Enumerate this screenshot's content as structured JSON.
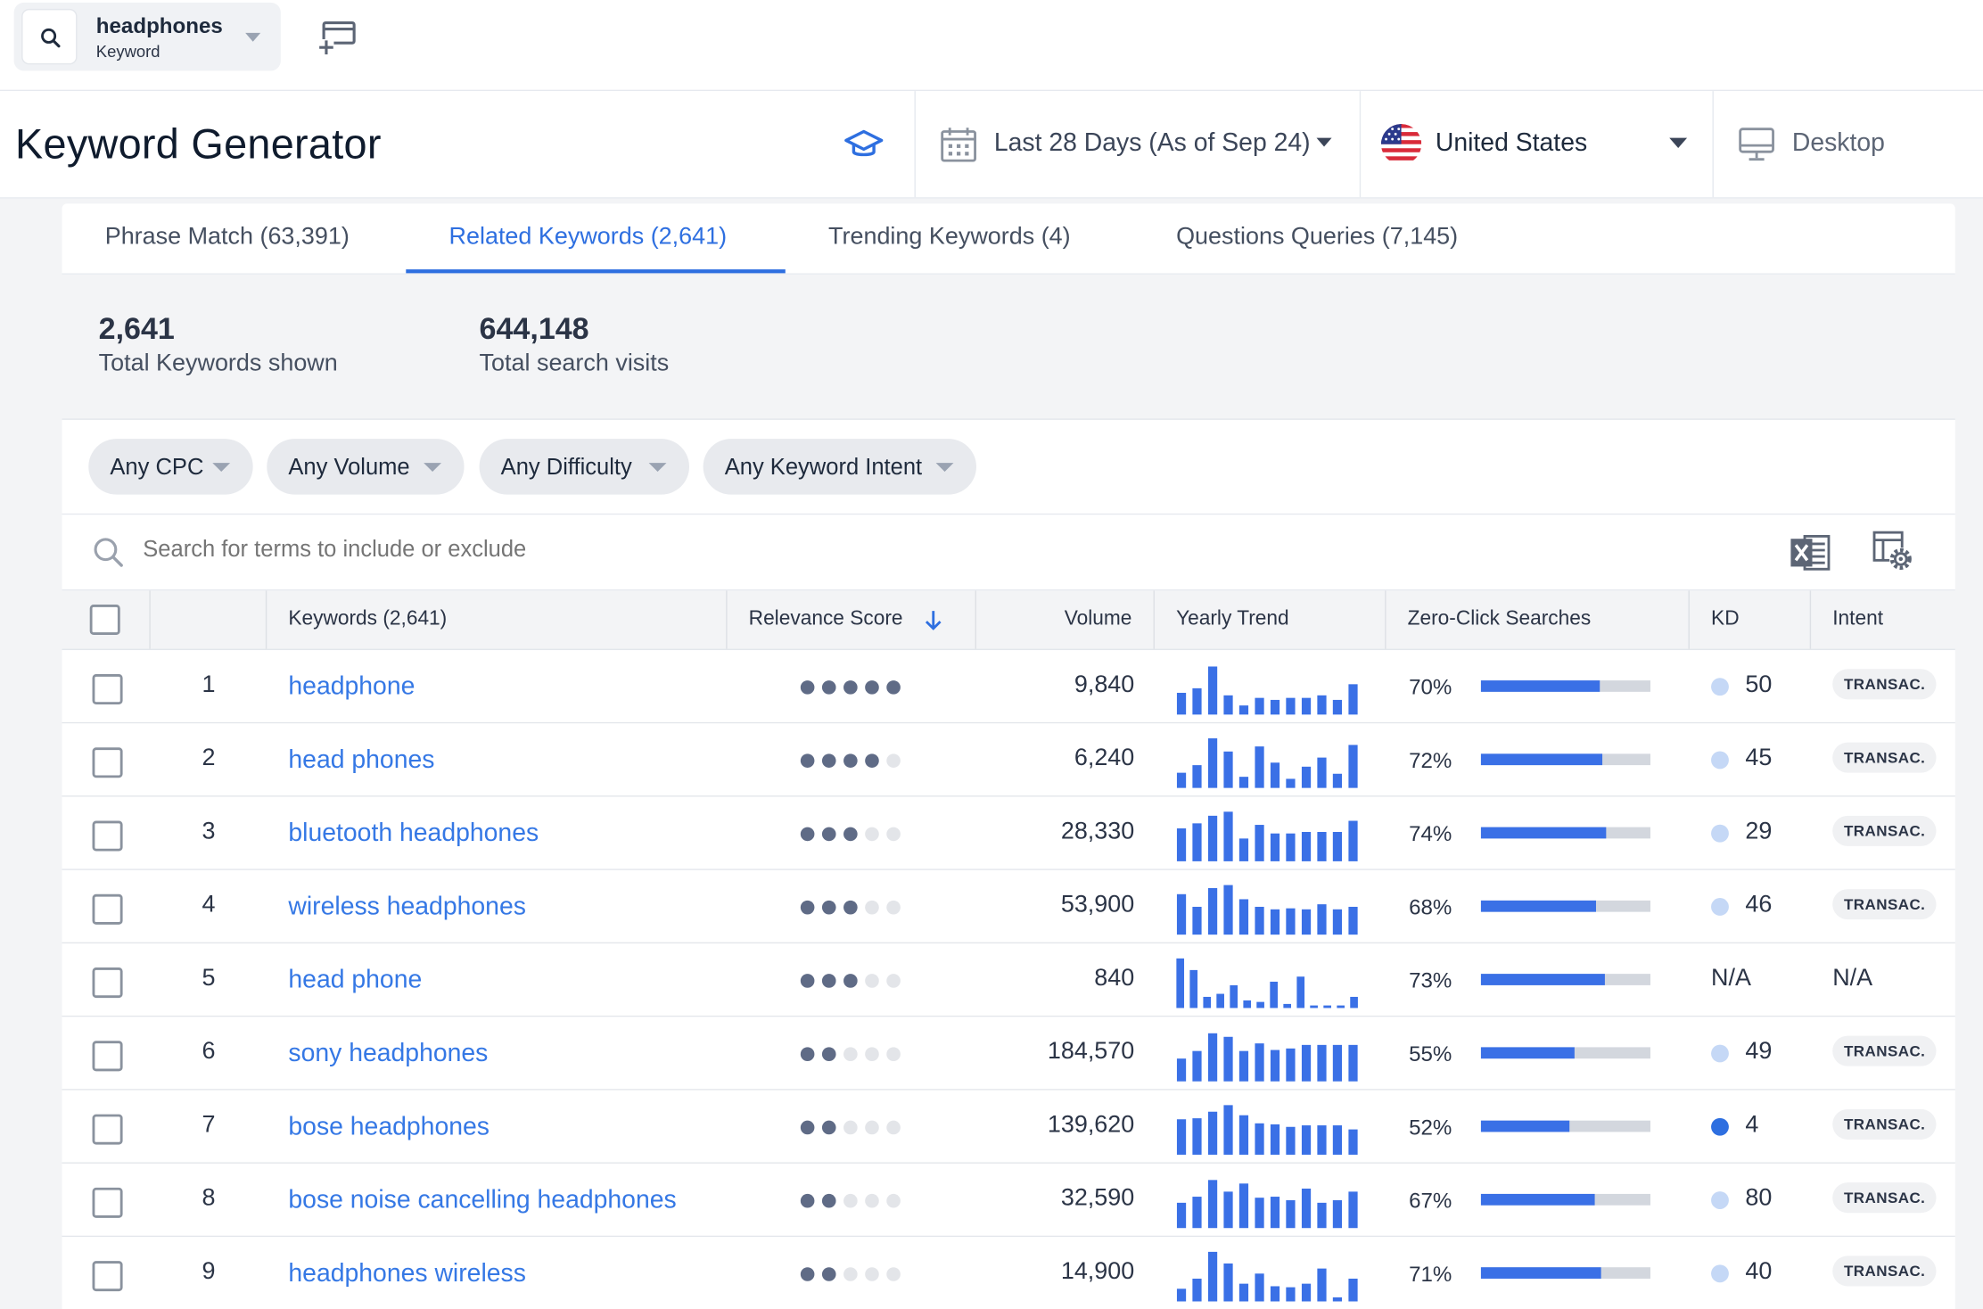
{
  "topbar": {
    "keyword": "headphones",
    "keyword_type": "Keyword"
  },
  "header": {
    "title": "Keyword Generator",
    "date_range": "Last 28 Days (As of Sep 24)",
    "country": "United States",
    "device": "Desktop"
  },
  "tabs": [
    {
      "label": "Phrase Match (63,391)"
    },
    {
      "label": "Related Keywords (2,641)"
    },
    {
      "label": "Trending Keywords (4)"
    },
    {
      "label": "Questions Queries (7,145)"
    }
  ],
  "stats": {
    "keywords_value": "2,641",
    "keywords_label": "Total Keywords shown",
    "visits_value": "644,148",
    "visits_label": "Total search visits"
  },
  "filters": {
    "cpc": "Any CPC",
    "volume": "Any Volume",
    "difficulty": "Any Difficulty",
    "intent": "Any Keyword Intent"
  },
  "search": {
    "placeholder": "Search for terms to include or exclude"
  },
  "table": {
    "headers": {
      "keywords": "Keywords (2,641)",
      "relevance": "Relevance Score",
      "volume": "Volume",
      "trend": "Yearly Trend",
      "zero_click": "Zero-Click Searches",
      "kd": "KD",
      "intent": "Intent"
    },
    "colors": {
      "link": "#3578e5",
      "trend_bar": "#3a70e6",
      "kd_light": "#c5d8f6",
      "kd_strong": "#2e6fe0"
    },
    "rows": [
      {
        "num": "1",
        "keyword": "headphone",
        "relevance": 5,
        "volume": "9,840",
        "trend": [
          0.43,
          0.52,
          0.95,
          0.38,
          0.18,
          0.33,
          0.29,
          0.33,
          0.33,
          0.38,
          0.29,
          0.6
        ],
        "zero_click": "70%",
        "zc_pct": 70,
        "kd": "50",
        "kd_level": "light",
        "intent": "TRANSAC."
      },
      {
        "num": "2",
        "keyword": "head phones",
        "relevance": 4,
        "volume": "6,240",
        "trend": [
          0.3,
          0.45,
          0.98,
          0.72,
          0.22,
          0.82,
          0.5,
          0.18,
          0.42,
          0.6,
          0.28,
          0.85
        ],
        "zero_click": "72%",
        "zc_pct": 72,
        "kd": "45",
        "kd_level": "light",
        "intent": "TRANSAC."
      },
      {
        "num": "3",
        "keyword": "bluetooth headphones",
        "relevance": 3,
        "volume": "28,330",
        "trend": [
          0.65,
          0.75,
          0.9,
          0.98,
          0.45,
          0.72,
          0.55,
          0.55,
          0.58,
          0.58,
          0.58,
          0.8
        ],
        "zero_click": "74%",
        "zc_pct": 74,
        "kd": "29",
        "kd_level": "light",
        "intent": "TRANSAC."
      },
      {
        "num": "4",
        "keyword": "wireless headphones",
        "relevance": 3,
        "volume": "53,900",
        "trend": [
          0.8,
          0.55,
          0.92,
          0.98,
          0.7,
          0.55,
          0.5,
          0.52,
          0.5,
          0.6,
          0.5,
          0.55
        ],
        "zero_click": "68%",
        "zc_pct": 68,
        "kd": "46",
        "kd_level": "light",
        "intent": "TRANSAC."
      },
      {
        "num": "5",
        "keyword": "head phone",
        "relevance": 3,
        "volume": "840",
        "trend": [
          0.98,
          0.75,
          0.22,
          0.28,
          0.45,
          0.15,
          0.12,
          0.52,
          0.08,
          0.62,
          0.05,
          0.05,
          0.05,
          0.22
        ],
        "zero_click": "73%",
        "zc_pct": 73,
        "kd": "N/A",
        "kd_level": "none",
        "intent": "N/A"
      },
      {
        "num": "6",
        "keyword": "sony headphones",
        "relevance": 2,
        "volume": "184,570",
        "trend": [
          0.45,
          0.6,
          0.95,
          0.88,
          0.6,
          0.75,
          0.62,
          0.65,
          0.72,
          0.72,
          0.72,
          0.72
        ],
        "zero_click": "55%",
        "zc_pct": 55,
        "kd": "49",
        "kd_level": "light",
        "intent": "TRANSAC."
      },
      {
        "num": "7",
        "keyword": "bose headphones",
        "relevance": 2,
        "volume": "139,620",
        "trend": [
          0.7,
          0.72,
          0.85,
          0.98,
          0.78,
          0.62,
          0.6,
          0.55,
          0.58,
          0.58,
          0.58,
          0.5
        ],
        "zero_click": "52%",
        "zc_pct": 52,
        "kd": "4",
        "kd_level": "strong",
        "intent": "TRANSAC."
      },
      {
        "num": "8",
        "keyword": "bose noise cancelling headphones",
        "relevance": 2,
        "volume": "32,590",
        "trend": [
          0.5,
          0.62,
          0.95,
          0.72,
          0.88,
          0.6,
          0.62,
          0.55,
          0.78,
          0.5,
          0.55,
          0.72
        ],
        "zero_click": "67%",
        "zc_pct": 67,
        "kd": "80",
        "kd_level": "light",
        "intent": "TRANSAC."
      },
      {
        "num": "9",
        "keyword": "headphones wireless",
        "relevance": 2,
        "volume": "14,900",
        "trend": [
          0.25,
          0.45,
          0.98,
          0.75,
          0.35,
          0.55,
          0.3,
          0.28,
          0.35,
          0.65,
          0.08,
          0.45
        ],
        "zero_click": "71%",
        "zc_pct": 71,
        "kd": "40",
        "kd_level": "light",
        "intent": "TRANSAC."
      }
    ]
  }
}
